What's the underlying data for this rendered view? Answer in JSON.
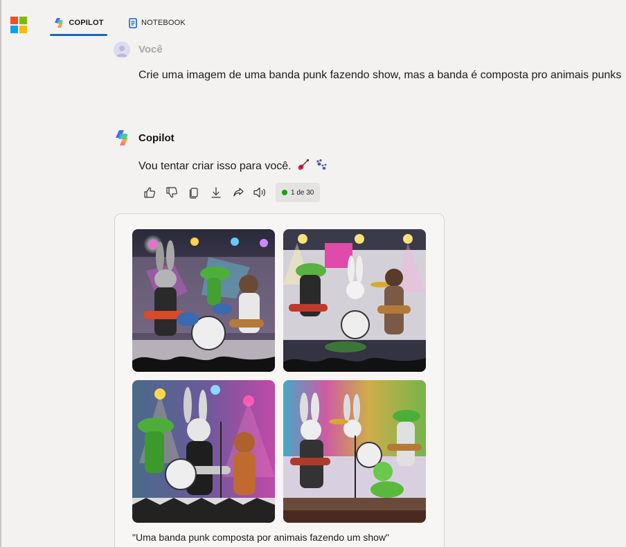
{
  "header": {
    "tabs": [
      {
        "label": "COPILOT",
        "icon": "copilot-logo-icon",
        "active": true
      },
      {
        "label": "NOTEBOOK",
        "icon": "notebook-icon",
        "active": false
      }
    ],
    "accent_color": "#0f6cbd"
  },
  "conversation": {
    "user": {
      "name": "Você",
      "message": "Crie uma imagem de uma banda punk fazendo show, mas a banda é composta pro animais punks"
    },
    "copilot": {
      "name": "Copilot",
      "message": "Vou tentar criar isso para você.",
      "emojis": [
        "guitar-emoji",
        "paw-prints-emoji"
      ],
      "actions": [
        "thumbs-up-icon",
        "thumbs-down-icon",
        "copy-icon",
        "download-icon",
        "share-icon",
        "read-aloud-icon"
      ],
      "counter": "1 de 30",
      "counter_color": "#13a10e"
    },
    "image_card": {
      "images": [
        {
          "name": "generated-image-1"
        },
        {
          "name": "generated-image-2"
        },
        {
          "name": "generated-image-3"
        },
        {
          "name": "generated-image-4"
        }
      ],
      "caption": "\"Uma banda punk composta por animais fazendo um show\""
    }
  }
}
